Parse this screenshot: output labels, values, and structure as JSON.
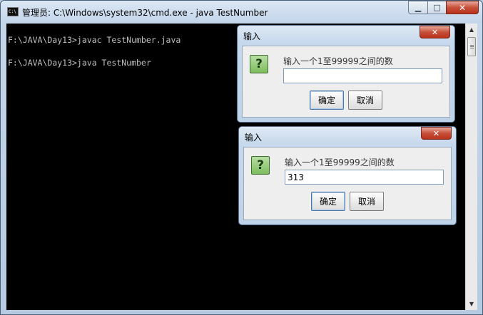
{
  "window": {
    "title": "管理员: C:\\Windows\\system32\\cmd.exe - java  TestNumber",
    "icon_text": "C:\\",
    "minimize_glyph": "▁",
    "maximize_glyph": "□",
    "close_glyph": "✕"
  },
  "console": {
    "lines": [
      "F:\\JAVA\\Day13>javac TestNumber.java",
      "F:\\JAVA\\Day13>java TestNumber"
    ]
  },
  "scrollbar": {
    "up_glyph": "▲",
    "down_glyph": "▼"
  },
  "dialogs": [
    {
      "title": "输入",
      "close_glyph": "✕",
      "icon_glyph": "?",
      "prompt": "输入一个1至99999之间的数",
      "value": "",
      "ok_label": "确定",
      "cancel_label": "取消"
    },
    {
      "title": "输入",
      "close_glyph": "✕",
      "icon_glyph": "?",
      "prompt": "输入一个1至99999之间的数",
      "value": "313",
      "ok_label": "确定",
      "cancel_label": "取消"
    }
  ],
  "colors": {
    "console_bg": "#000000",
    "console_text": "#c0c0c0",
    "question_icon": "#7cbc5c",
    "close_button": "#c7503a"
  }
}
